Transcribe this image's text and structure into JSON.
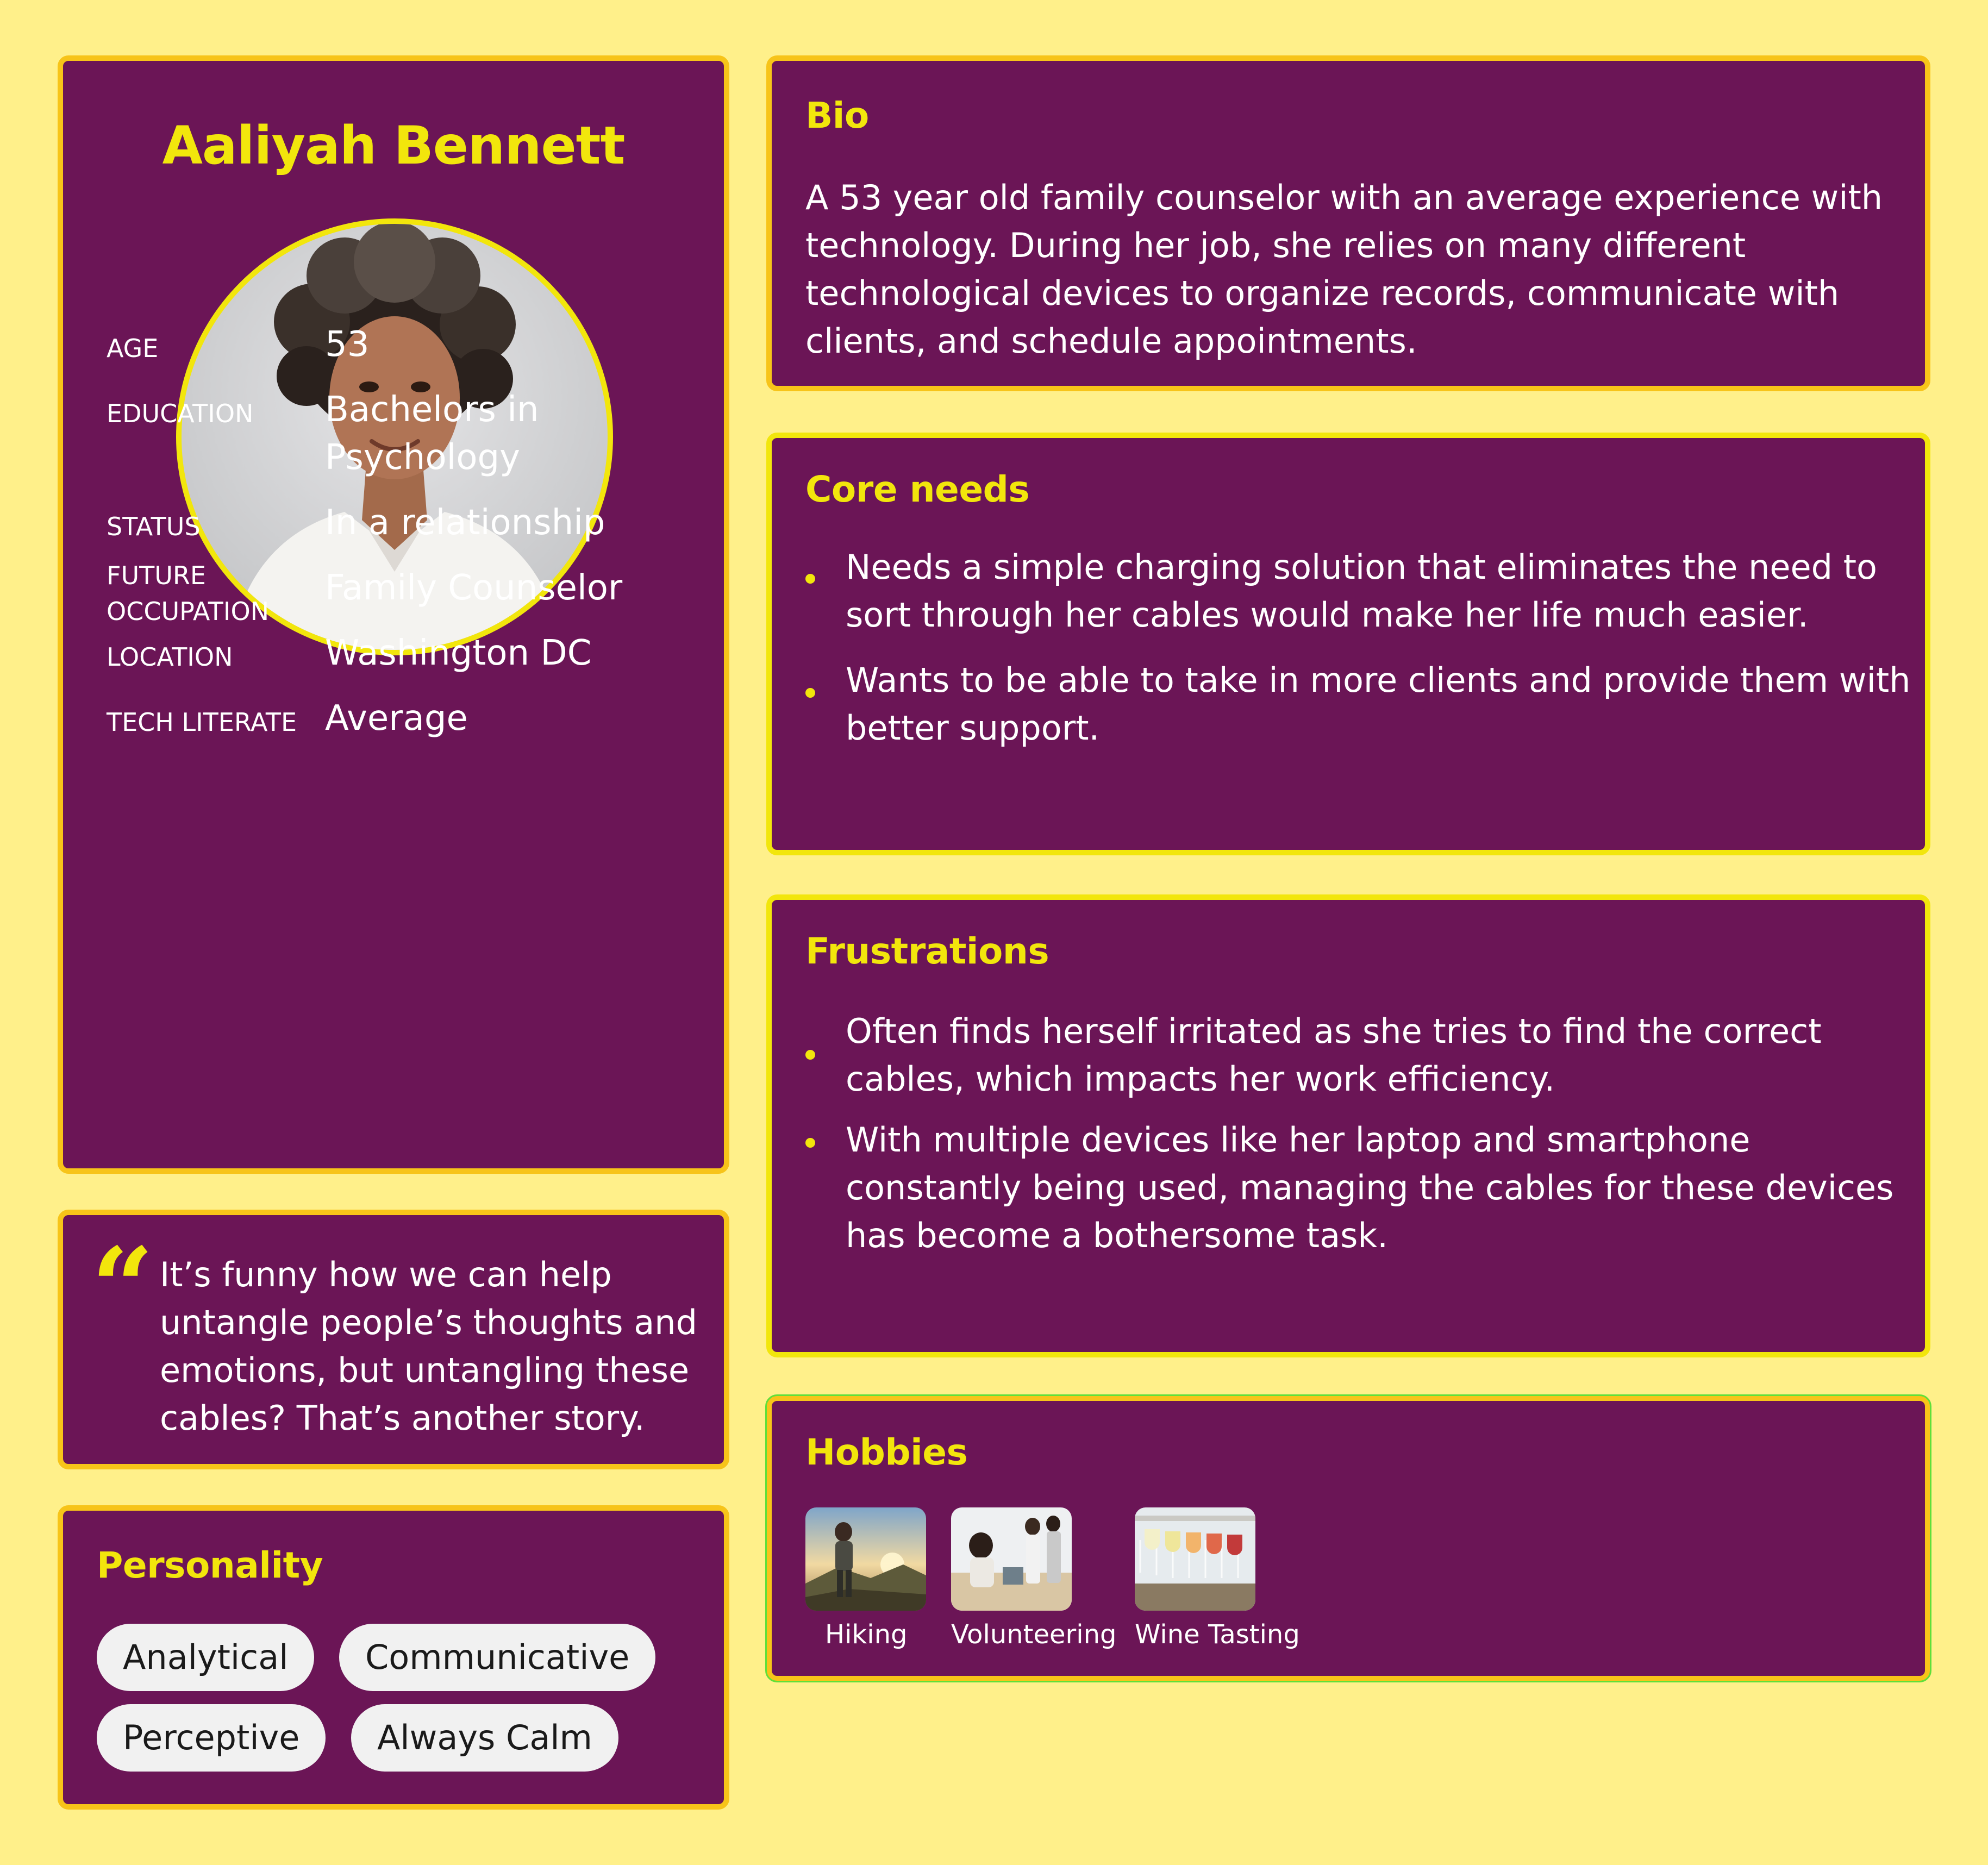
{
  "profile": {
    "name": "Aaliyah Bennett",
    "fields": [
      {
        "label": "AGE",
        "value": "53"
      },
      {
        "label": "EDUCATION",
        "value": "Bachelors in\nPsychology"
      },
      {
        "label": "STATUS",
        "value": "In a relationship"
      },
      {
        "label": "FUTURE\nOCCUPATION",
        "value": "Family Counselor"
      },
      {
        "label": "LOCATION",
        "value": "Washington DC"
      },
      {
        "label": "TECH LITERATE",
        "value": "Average"
      }
    ]
  },
  "quote": {
    "text": "It’s funny how we can help untangle people’s thoughts and emotions, but untangling these cables? That’s another story."
  },
  "personality": {
    "title": "Personality",
    "traits": [
      "Analytical",
      "Communicative",
      "Perceptive",
      "Always Calm"
    ]
  },
  "bio": {
    "title": "Bio",
    "text": "A 53 year old family counselor with an average experience with technology. During her job, she relies on many different technological devices to organize records, communicate with clients, and schedule appointments."
  },
  "core_needs": {
    "title": "Core needs",
    "items": [
      " Needs a simple charging solution that eliminates the need to sort through her cables would make her life much easier.",
      "Wants to be able to take in more clients and provide them with better support."
    ]
  },
  "frustrations": {
    "title": "Frustrations",
    "items": [
      "Often finds herself irritated as she tries to find the correct cables, which impacts her work efficiency.",
      "With multiple devices like her laptop and smartphone constantly being used, managing the cables for these devices has become a bothersome task."
    ]
  },
  "hobbies": {
    "title": "Hobbies",
    "items": [
      {
        "label": "Hiking",
        "image": "hiking-photo"
      },
      {
        "label": "Volunteering",
        "image": "volunteering-photo"
      },
      {
        "label": "Wine Tasting",
        "image": "wine-tasting-photo"
      }
    ]
  },
  "colors": {
    "background": "#fff08a",
    "card": "#6b1556",
    "accent": "#f2e60c",
    "border": "#f7c419"
  }
}
